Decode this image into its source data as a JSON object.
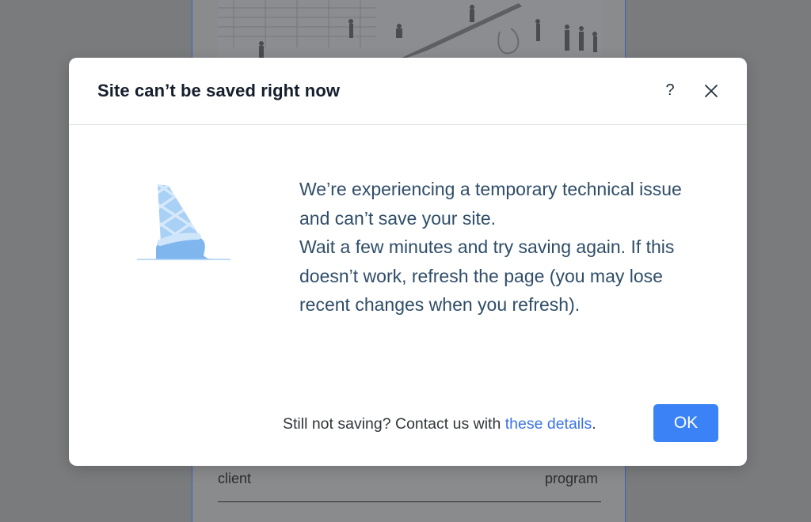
{
  "background_page": {
    "row_left_label": "client",
    "row_right_label": "program"
  },
  "dialog": {
    "title": "Site can’t be saved right now",
    "help_label": "?",
    "message_line_1": "We’re experiencing a temporary technical issue and can’t save your site.",
    "message_line_2": "Wait a few minutes and try saving again. If this doesn’t work, refresh the page (you may lose recent changes when you refresh).",
    "footer_prefix": "Still not saving? Contact us with",
    "footer_link": "these details",
    "footer_suffix": ".",
    "ok_label": "OK"
  },
  "colors": {
    "overlay": "#7a7b7d",
    "title": "#151e2c",
    "message": "#2f4d68",
    "link": "#3a73e6",
    "primary_button": "#3b82f6",
    "illustration_blue": "#a9d0f5"
  },
  "icons": [
    "help-icon",
    "close-icon",
    "melted-ice-cream-cone-illustration"
  ]
}
